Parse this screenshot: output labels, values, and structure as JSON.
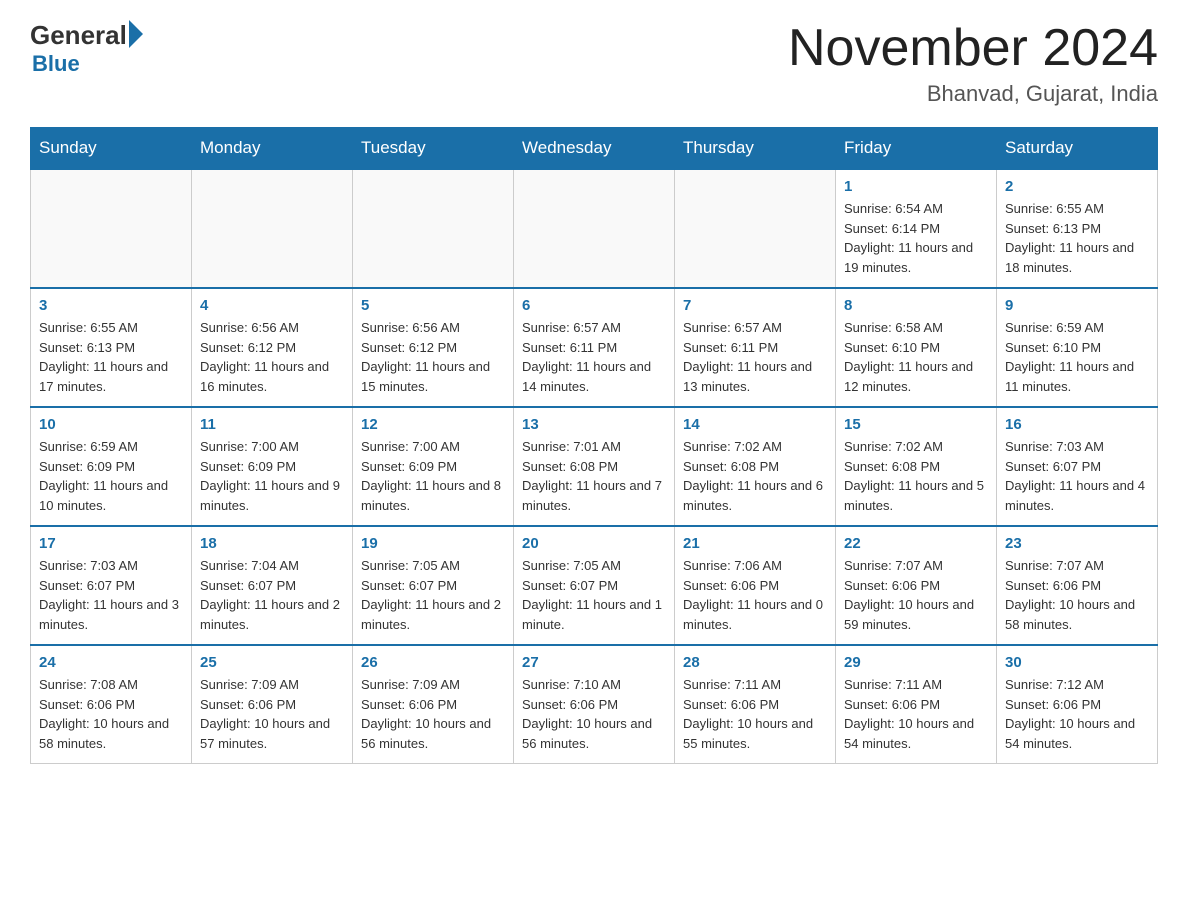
{
  "logo": {
    "general": "General",
    "blue": "Blue"
  },
  "title": "November 2024",
  "location": "Bhanvad, Gujarat, India",
  "days_of_week": [
    "Sunday",
    "Monday",
    "Tuesday",
    "Wednesday",
    "Thursday",
    "Friday",
    "Saturday"
  ],
  "weeks": [
    [
      {
        "day": "",
        "info": ""
      },
      {
        "day": "",
        "info": ""
      },
      {
        "day": "",
        "info": ""
      },
      {
        "day": "",
        "info": ""
      },
      {
        "day": "",
        "info": ""
      },
      {
        "day": "1",
        "info": "Sunrise: 6:54 AM\nSunset: 6:14 PM\nDaylight: 11 hours and 19 minutes."
      },
      {
        "day": "2",
        "info": "Sunrise: 6:55 AM\nSunset: 6:13 PM\nDaylight: 11 hours and 18 minutes."
      }
    ],
    [
      {
        "day": "3",
        "info": "Sunrise: 6:55 AM\nSunset: 6:13 PM\nDaylight: 11 hours and 17 minutes."
      },
      {
        "day": "4",
        "info": "Sunrise: 6:56 AM\nSunset: 6:12 PM\nDaylight: 11 hours and 16 minutes."
      },
      {
        "day": "5",
        "info": "Sunrise: 6:56 AM\nSunset: 6:12 PM\nDaylight: 11 hours and 15 minutes."
      },
      {
        "day": "6",
        "info": "Sunrise: 6:57 AM\nSunset: 6:11 PM\nDaylight: 11 hours and 14 minutes."
      },
      {
        "day": "7",
        "info": "Sunrise: 6:57 AM\nSunset: 6:11 PM\nDaylight: 11 hours and 13 minutes."
      },
      {
        "day": "8",
        "info": "Sunrise: 6:58 AM\nSunset: 6:10 PM\nDaylight: 11 hours and 12 minutes."
      },
      {
        "day": "9",
        "info": "Sunrise: 6:59 AM\nSunset: 6:10 PM\nDaylight: 11 hours and 11 minutes."
      }
    ],
    [
      {
        "day": "10",
        "info": "Sunrise: 6:59 AM\nSunset: 6:09 PM\nDaylight: 11 hours and 10 minutes."
      },
      {
        "day": "11",
        "info": "Sunrise: 7:00 AM\nSunset: 6:09 PM\nDaylight: 11 hours and 9 minutes."
      },
      {
        "day": "12",
        "info": "Sunrise: 7:00 AM\nSunset: 6:09 PM\nDaylight: 11 hours and 8 minutes."
      },
      {
        "day": "13",
        "info": "Sunrise: 7:01 AM\nSunset: 6:08 PM\nDaylight: 11 hours and 7 minutes."
      },
      {
        "day": "14",
        "info": "Sunrise: 7:02 AM\nSunset: 6:08 PM\nDaylight: 11 hours and 6 minutes."
      },
      {
        "day": "15",
        "info": "Sunrise: 7:02 AM\nSunset: 6:08 PM\nDaylight: 11 hours and 5 minutes."
      },
      {
        "day": "16",
        "info": "Sunrise: 7:03 AM\nSunset: 6:07 PM\nDaylight: 11 hours and 4 minutes."
      }
    ],
    [
      {
        "day": "17",
        "info": "Sunrise: 7:03 AM\nSunset: 6:07 PM\nDaylight: 11 hours and 3 minutes."
      },
      {
        "day": "18",
        "info": "Sunrise: 7:04 AM\nSunset: 6:07 PM\nDaylight: 11 hours and 2 minutes."
      },
      {
        "day": "19",
        "info": "Sunrise: 7:05 AM\nSunset: 6:07 PM\nDaylight: 11 hours and 2 minutes."
      },
      {
        "day": "20",
        "info": "Sunrise: 7:05 AM\nSunset: 6:07 PM\nDaylight: 11 hours and 1 minute."
      },
      {
        "day": "21",
        "info": "Sunrise: 7:06 AM\nSunset: 6:06 PM\nDaylight: 11 hours and 0 minutes."
      },
      {
        "day": "22",
        "info": "Sunrise: 7:07 AM\nSunset: 6:06 PM\nDaylight: 10 hours and 59 minutes."
      },
      {
        "day": "23",
        "info": "Sunrise: 7:07 AM\nSunset: 6:06 PM\nDaylight: 10 hours and 58 minutes."
      }
    ],
    [
      {
        "day": "24",
        "info": "Sunrise: 7:08 AM\nSunset: 6:06 PM\nDaylight: 10 hours and 58 minutes."
      },
      {
        "day": "25",
        "info": "Sunrise: 7:09 AM\nSunset: 6:06 PM\nDaylight: 10 hours and 57 minutes."
      },
      {
        "day": "26",
        "info": "Sunrise: 7:09 AM\nSunset: 6:06 PM\nDaylight: 10 hours and 56 minutes."
      },
      {
        "day": "27",
        "info": "Sunrise: 7:10 AM\nSunset: 6:06 PM\nDaylight: 10 hours and 56 minutes."
      },
      {
        "day": "28",
        "info": "Sunrise: 7:11 AM\nSunset: 6:06 PM\nDaylight: 10 hours and 55 minutes."
      },
      {
        "day": "29",
        "info": "Sunrise: 7:11 AM\nSunset: 6:06 PM\nDaylight: 10 hours and 54 minutes."
      },
      {
        "day": "30",
        "info": "Sunrise: 7:12 AM\nSunset: 6:06 PM\nDaylight: 10 hours and 54 minutes."
      }
    ]
  ]
}
